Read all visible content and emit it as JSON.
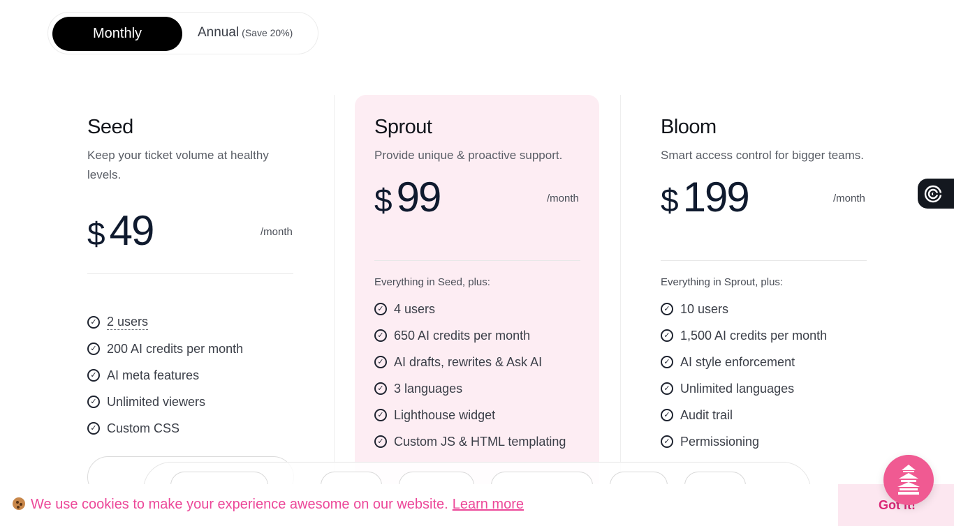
{
  "billing_toggle": {
    "monthly": "Monthly",
    "annual": "Annual",
    "annual_note": "(Save 20%)"
  },
  "plans": [
    {
      "name": "Seed",
      "description": "Keep your ticket volume at healthy levels.",
      "currency": "$",
      "price": "49",
      "period": "/month",
      "intro": "",
      "features": [
        "2 users",
        "200 AI credits per month",
        "AI meta features",
        "Unlimited viewers",
        "Custom CSS"
      ]
    },
    {
      "name": "Sprout",
      "description": "Provide unique & proactive support.",
      "currency": "$",
      "price": "99",
      "period": "/month",
      "intro": "Everything in Seed, plus:",
      "features": [
        "4 users",
        "650 AI credits per month",
        "AI drafts, rewrites & Ask AI",
        "3 languages",
        "Lighthouse widget",
        "Custom JS & HTML templating"
      ]
    },
    {
      "name": "Bloom",
      "description": "Smart access control for bigger teams.",
      "currency": "$",
      "price": "199",
      "period": "/month",
      "intro": "Everything in Sprout, plus:",
      "features": [
        "10 users",
        "1,500 AI credits per month",
        "AI style enforcement",
        "Unlimited languages",
        "Audit trail",
        "Permissioning"
      ]
    }
  ],
  "cookie_banner": {
    "text": "We use cookies to make your experience awesome on our website.",
    "learn_more": "Learn more",
    "accept": "Got it!"
  },
  "icons": {
    "check": "check-circle-icon",
    "side_tab": "target-icon",
    "launcher": "pagoda-icon",
    "cookie": "cookie-icon"
  },
  "colors": {
    "accent_pink": "#ec4899",
    "featured_bg": "#fdedf3",
    "price_navy": "#0f1a2e",
    "toggle_active": "#000000"
  }
}
